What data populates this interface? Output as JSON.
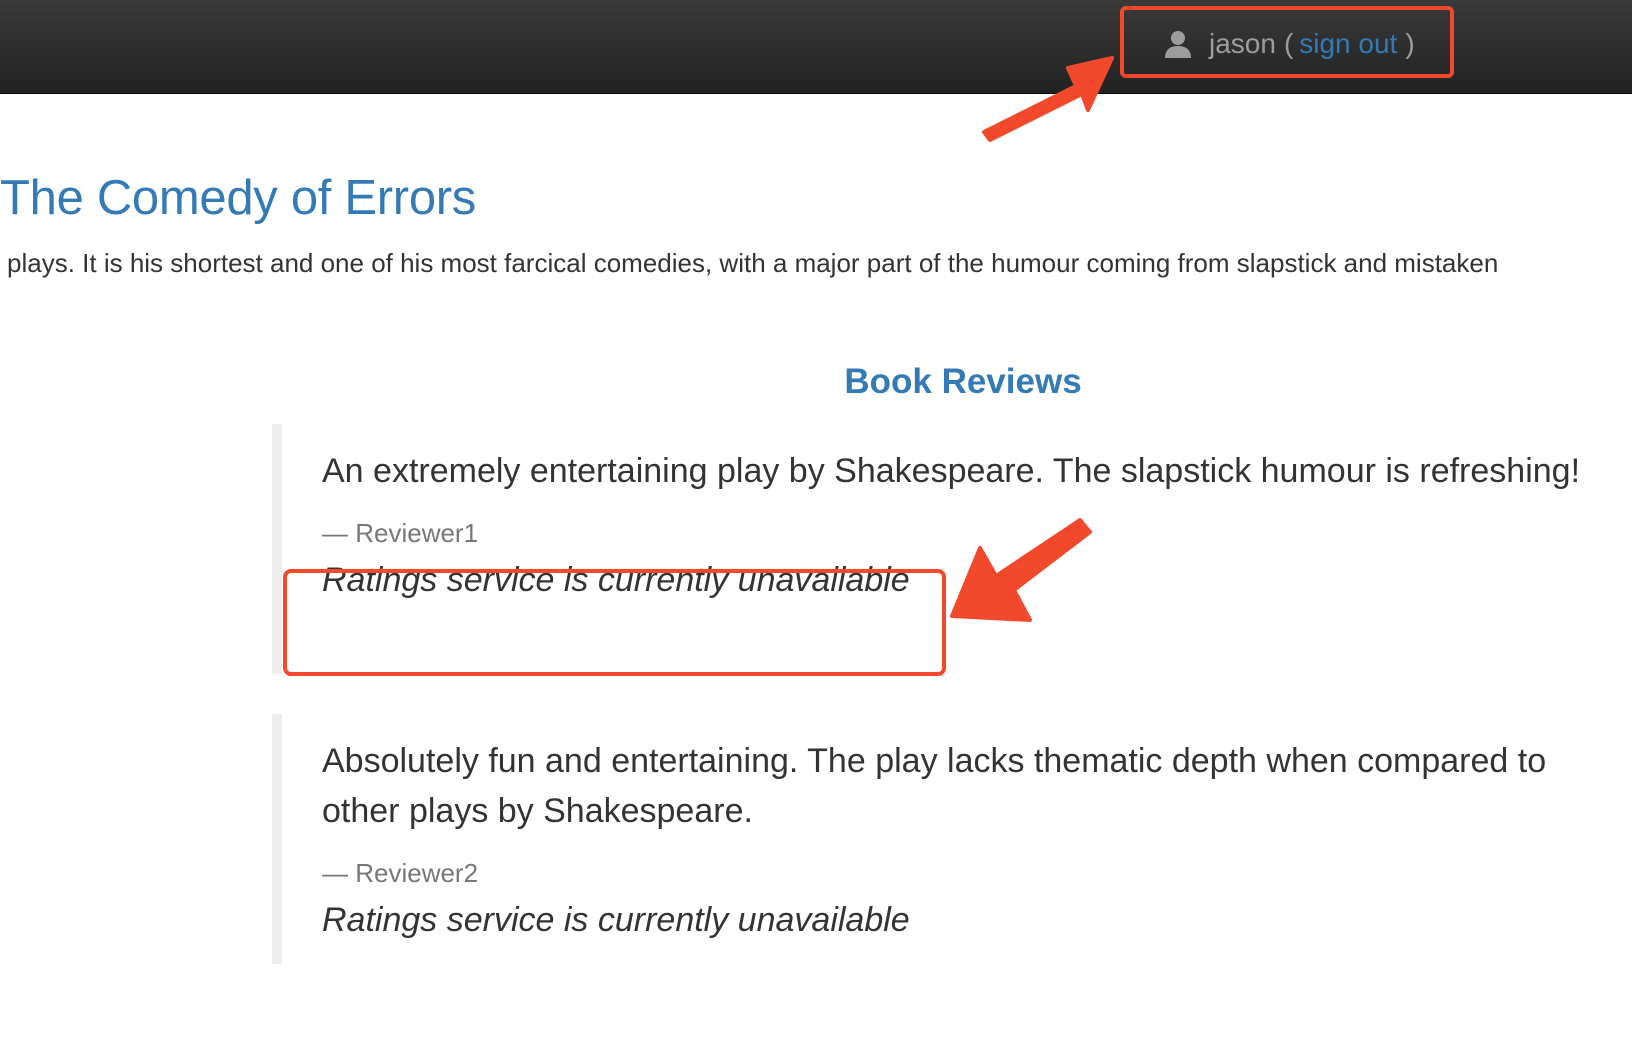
{
  "navbar": {
    "user_name": "jason",
    "open_paren": "(",
    "sign_out_label": "sign out",
    "close_paren": ")",
    "user_icon": "user-icon"
  },
  "book": {
    "title": "The Comedy of Errors",
    "summary": "plays. It is his shortest and one of his most farcical comedies, with a major part of the humour coming from slapstick and mistaken"
  },
  "reviews": {
    "heading": "Book Reviews",
    "items": [
      {
        "text": "An extremely entertaining play by Shakespeare. The slapstick humour is refreshing!",
        "reviewer": "— Reviewer1",
        "rating": "Ratings service is currently unavailable"
      },
      {
        "text": "Absolutely fun and entertaining. The play lacks thematic depth when compared to other plays by Shakespeare.",
        "reviewer": "— Reviewer2",
        "rating": "Ratings service is currently unavailable"
      }
    ]
  },
  "annotations": {
    "highlight_color": "#f2492d"
  },
  "colors": {
    "link": "#337ab7",
    "navbar": "#222222"
  }
}
